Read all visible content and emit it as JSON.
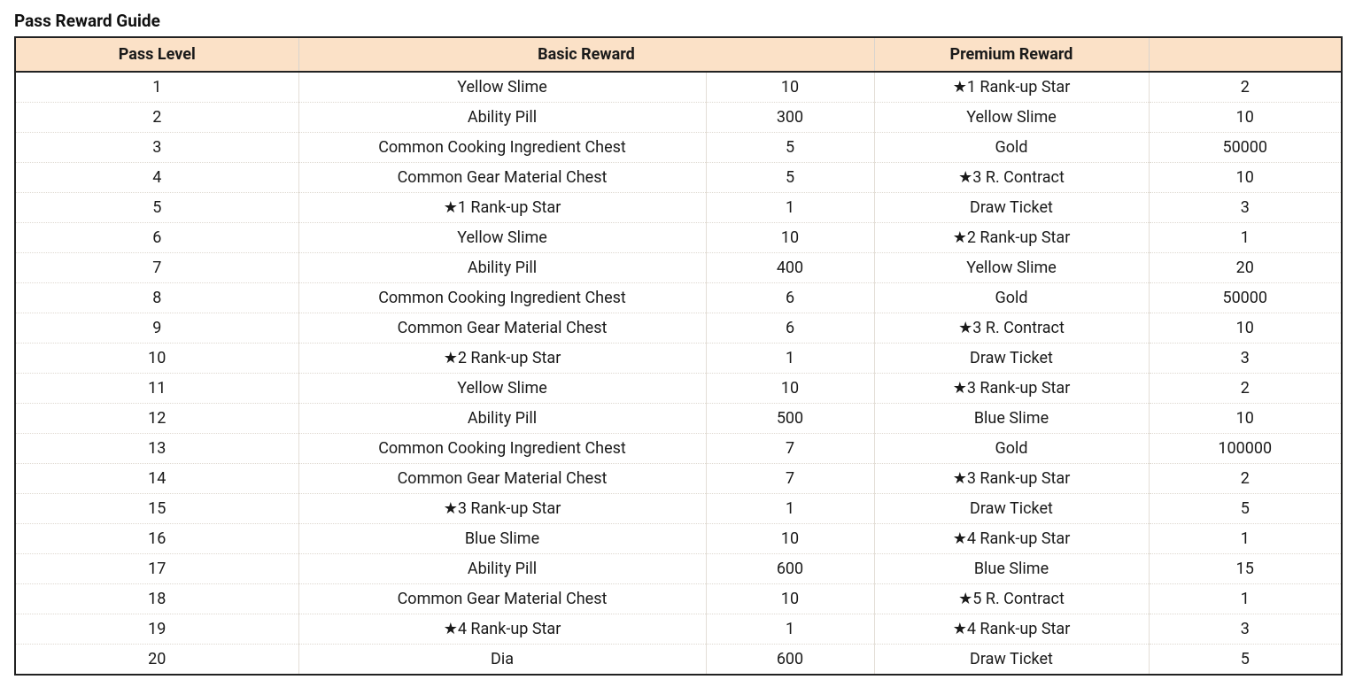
{
  "title": "Pass Reward Guide",
  "chart_data": {
    "type": "table",
    "headers": [
      "Pass Level",
      "Basic Reward",
      "",
      "Premium Reward",
      ""
    ],
    "rows": [
      {
        "level": "1",
        "basic_item": "Yellow Slime",
        "basic_qty": "10",
        "premium_item": "★1 Rank-up Star",
        "premium_qty": "2"
      },
      {
        "level": "2",
        "basic_item": "Ability Pill",
        "basic_qty": "300",
        "premium_item": "Yellow Slime",
        "premium_qty": "10"
      },
      {
        "level": "3",
        "basic_item": "Common Cooking Ingredient Chest",
        "basic_qty": "5",
        "premium_item": "Gold",
        "premium_qty": "50000"
      },
      {
        "level": "4",
        "basic_item": "Common Gear Material Chest",
        "basic_qty": "5",
        "premium_item": "★3 R. Contract",
        "premium_qty": "10"
      },
      {
        "level": "5",
        "basic_item": "★1 Rank-up Star",
        "basic_qty": "1",
        "premium_item": "Draw Ticket",
        "premium_qty": "3"
      },
      {
        "level": "6",
        "basic_item": "Yellow Slime",
        "basic_qty": "10",
        "premium_item": "★2 Rank-up Star",
        "premium_qty": "1"
      },
      {
        "level": "7",
        "basic_item": "Ability Pill",
        "basic_qty": "400",
        "premium_item": "Yellow Slime",
        "premium_qty": "20"
      },
      {
        "level": "8",
        "basic_item": "Common Cooking Ingredient Chest",
        "basic_qty": "6",
        "premium_item": "Gold",
        "premium_qty": "50000"
      },
      {
        "level": "9",
        "basic_item": "Common Gear Material Chest",
        "basic_qty": "6",
        "premium_item": "★3 R. Contract",
        "premium_qty": "10"
      },
      {
        "level": "10",
        "basic_item": "★2 Rank-up Star",
        "basic_qty": "1",
        "premium_item": "Draw Ticket",
        "premium_qty": "3"
      },
      {
        "level": "11",
        "basic_item": "Yellow Slime",
        "basic_qty": "10",
        "premium_item": "★3 Rank-up Star",
        "premium_qty": "2"
      },
      {
        "level": "12",
        "basic_item": "Ability Pill",
        "basic_qty": "500",
        "premium_item": "Blue Slime",
        "premium_qty": "10"
      },
      {
        "level": "13",
        "basic_item": "Common Cooking Ingredient Chest",
        "basic_qty": "7",
        "premium_item": "Gold",
        "premium_qty": "100000"
      },
      {
        "level": "14",
        "basic_item": "Common Gear Material Chest",
        "basic_qty": "7",
        "premium_item": "★3 Rank-up Star",
        "premium_qty": "2"
      },
      {
        "level": "15",
        "basic_item": "★3 Rank-up Star",
        "basic_qty": "1",
        "premium_item": "Draw Ticket",
        "premium_qty": "5"
      },
      {
        "level": "16",
        "basic_item": "Blue Slime",
        "basic_qty": "10",
        "premium_item": "★4 Rank-up Star",
        "premium_qty": "1"
      },
      {
        "level": "17",
        "basic_item": "Ability Pill",
        "basic_qty": "600",
        "premium_item": "Blue Slime",
        "premium_qty": "15"
      },
      {
        "level": "18",
        "basic_item": "Common Gear Material Chest",
        "basic_qty": "10",
        "premium_item": "★5 R. Contract",
        "premium_qty": "1"
      },
      {
        "level": "19",
        "basic_item": "★4 Rank-up Star",
        "basic_qty": "1",
        "premium_item": "★4 Rank-up Star",
        "premium_qty": "3"
      },
      {
        "level": "20",
        "basic_item": "Dia",
        "basic_qty": "600",
        "premium_item": "Draw Ticket",
        "premium_qty": "5"
      }
    ]
  }
}
